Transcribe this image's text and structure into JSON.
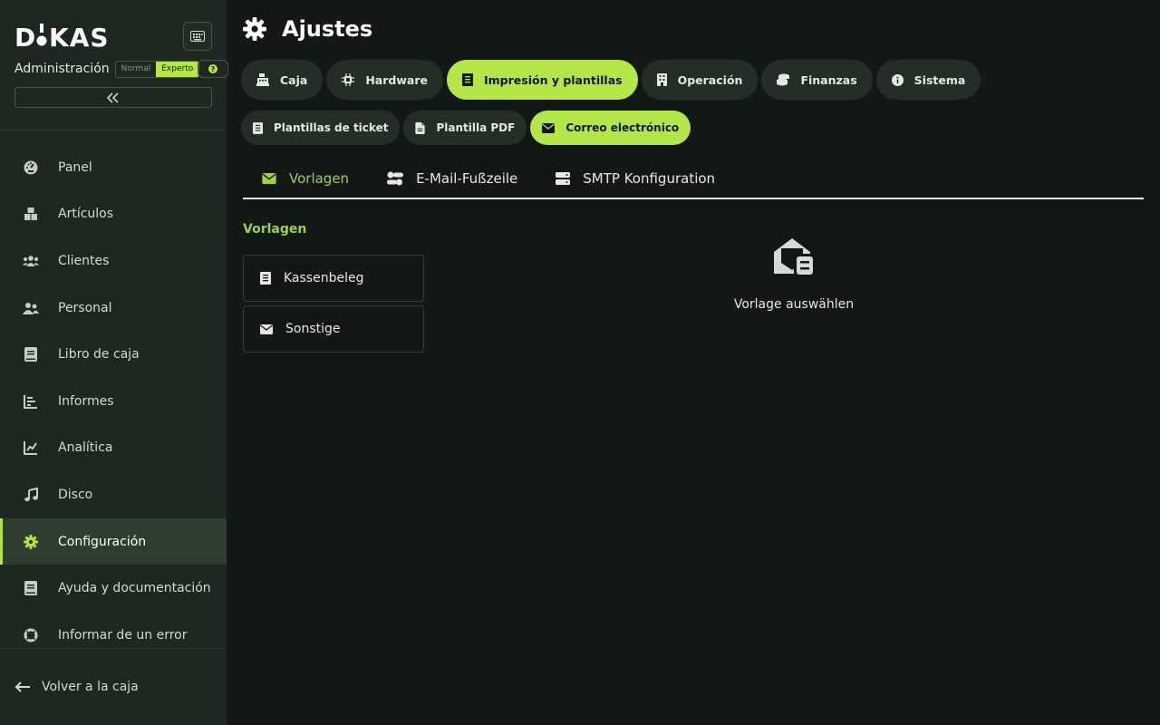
{
  "colors": {
    "accent": "#b4e64a",
    "accent_text": "#9ed14a",
    "sidebar_bg": "#1f2820",
    "page_bg": "#141814"
  },
  "brand": {
    "logo": "DKAS"
  },
  "sidebar": {
    "admin_label": "Administración",
    "modes": [
      "Normal",
      "Experto"
    ],
    "active_mode": "Experto",
    "collapse_icon": "double-chevron-left-icon",
    "items": [
      {
        "label": "Panel",
        "icon": "dashboard-icon"
      },
      {
        "label": "Artículos",
        "icon": "boxes-icon"
      },
      {
        "label": "Clientes",
        "icon": "users-icon"
      },
      {
        "label": "Personal",
        "icon": "user-group-icon"
      },
      {
        "label": "Libro de caja",
        "icon": "book-icon"
      },
      {
        "label": "Informes",
        "icon": "bar-chart-icon"
      },
      {
        "label": "Analítica",
        "icon": "line-chart-icon"
      },
      {
        "label": "Disco",
        "icon": "music-icon"
      },
      {
        "label": "Configuración",
        "icon": "gear-icon",
        "active": true
      },
      {
        "label": "Ayuda y documentación",
        "icon": "book-icon"
      },
      {
        "label": "Informar de un error",
        "icon": "lifebuoy-icon"
      }
    ],
    "back_label": "Volver a la caja"
  },
  "page": {
    "title": "Ajustes"
  },
  "settings_tabs": [
    {
      "label": "Caja",
      "icon": "cash-register-icon"
    },
    {
      "label": "Hardware",
      "icon": "chip-icon"
    },
    {
      "label": "Impresión y plantillas",
      "icon": "receipt-icon",
      "active": true
    },
    {
      "label": "Operación",
      "icon": "building-icon"
    },
    {
      "label": "Finanzas",
      "icon": "coins-icon"
    },
    {
      "label": "Sistema",
      "icon": "info-icon"
    }
  ],
  "sub_tabs": [
    {
      "label": "Plantillas de ticket",
      "icon": "receipt-icon"
    },
    {
      "label": "Plantilla PDF",
      "icon": "file-icon"
    },
    {
      "label": "Correo electrónico",
      "icon": "envelope-icon",
      "active": true
    }
  ],
  "email_tabs": [
    {
      "label": "Vorlagen",
      "icon": "envelope-icon",
      "active": true
    },
    {
      "label": "E-Mail-Fußzeile",
      "icon": "toggle-icon"
    },
    {
      "label": "SMTP Konfiguration",
      "icon": "server-icon"
    }
  ],
  "templates": {
    "section_label": "Vorlagen",
    "items": [
      {
        "label": "Kassenbeleg",
        "icon": "receipt-icon"
      },
      {
        "label": "Sonstige",
        "icon": "envelope-icon"
      }
    ],
    "empty_message": "Vorlage auswählen",
    "empty_icon": "envelope-open-text-icon"
  }
}
